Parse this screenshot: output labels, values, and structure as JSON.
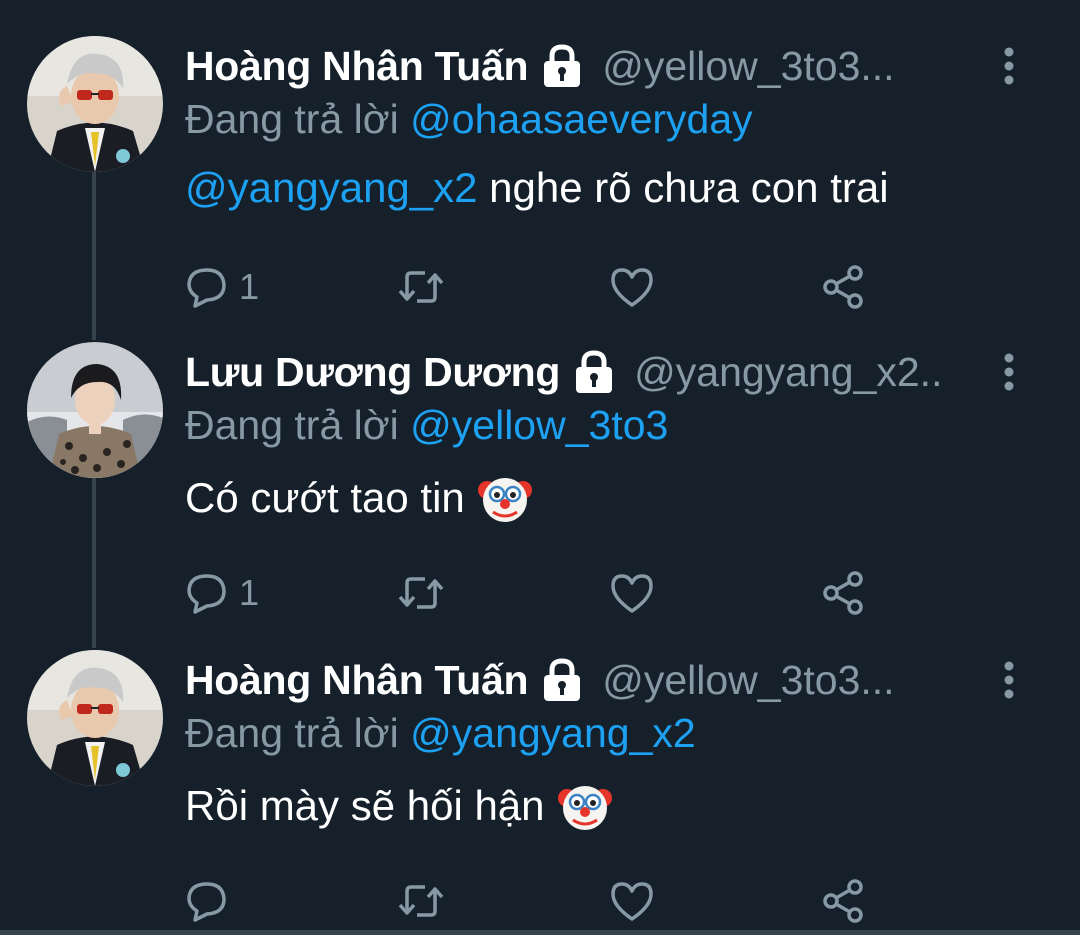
{
  "tweets": [
    {
      "display_name": "Hoàng Nhân Tuấn",
      "handle": "@yellow_3to3...",
      "replying_label": "Đang trả lời",
      "replying_to": "@ohaasaeveryday",
      "body_mention": "@yangyang_x2",
      "body_text": " nghe rõ chưa con trai",
      "reply_count": "1",
      "has_emoji": false,
      "avatar_icon": "avatar-man-sunglasses-suit"
    },
    {
      "display_name": "Lưu Dương Dương",
      "handle": "@yangyang_x2..",
      "replying_label": "Đang trả lời",
      "replying_to": "@yellow_3to3",
      "body_mention": "",
      "body_text": "Có cướt tao tin",
      "reply_count": "1",
      "has_emoji": true,
      "emoji_icon": "clown-face-icon",
      "avatar_icon": "avatar-man-leopard-coat-snow"
    },
    {
      "display_name": "Hoàng Nhân Tuấn",
      "handle": "@yellow_3to3...",
      "replying_label": "Đang trả lời",
      "replying_to": "@yangyang_x2",
      "body_mention": "",
      "body_text": "Rồi mày sẽ hối hận",
      "reply_count": "",
      "has_emoji": true,
      "emoji_icon": "clown-face-icon",
      "avatar_icon": "avatar-man-sunglasses-suit"
    }
  ],
  "icons": {
    "lock": "lock-icon",
    "more": "more-vertical-icon",
    "reply": "reply-icon",
    "retweet": "retweet-icon",
    "like": "heart-icon",
    "share": "share-icon"
  },
  "colors": {
    "background": "#15202b",
    "primary_text": "#ffffff",
    "secondary_text": "#8899a6",
    "mention": "#1da1f2",
    "thread_line": "#38444d"
  }
}
